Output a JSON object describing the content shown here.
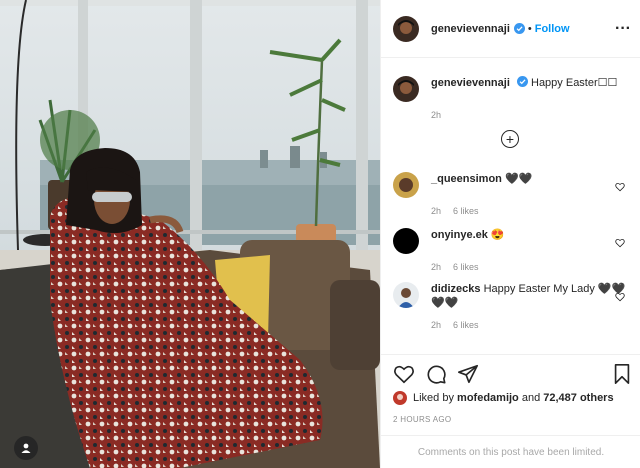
{
  "post": {
    "author": "genevievennaji",
    "follow_label": "Follow",
    "separator": "•",
    "more_label": "···",
    "caption_user": "genevievennaji",
    "caption_text": "Happy Easter☐☐",
    "caption_time": "2h",
    "load_more_label": "+"
  },
  "comments": [
    {
      "user": "_queensimon",
      "text": "🖤🖤",
      "time": "2h",
      "likes": "6 likes"
    },
    {
      "user": "onyinye.ek",
      "text": "😍",
      "time": "2h",
      "likes": "6 likes"
    },
    {
      "user": "didizecks",
      "text": "Happy Easter My Lady 🖤🖤🖤🖤",
      "time": "2h",
      "likes": "6 likes"
    }
  ],
  "engagement": {
    "liked_prefix": "Liked by",
    "liked_user": "mofedamijo",
    "liked_and": "and",
    "liked_count": "72,487 others",
    "time_ago": "2 HOURS AGO",
    "comments_limited": "Comments on this post have been limited."
  },
  "colors": {
    "accent": "#0095f6",
    "verified": "#3897f0",
    "muted": "#8e8e8e"
  },
  "icons": [
    "verified-badge-icon",
    "more-options-icon",
    "plus-circle-icon",
    "heart-icon",
    "comment-icon",
    "share-icon",
    "bookmark-icon",
    "user-tag-icon"
  ]
}
